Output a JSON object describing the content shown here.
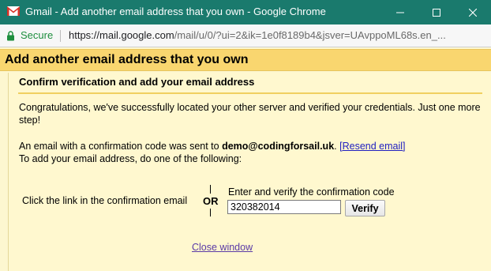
{
  "window": {
    "title": "Gmail - Add another email address that you own - Google Chrome",
    "controls": [
      "minimize",
      "maximize",
      "close"
    ]
  },
  "addressbar": {
    "secure_label": "Secure",
    "url_host": "https://mail.google.com",
    "url_rest": "/mail/u/0/?ui=2&ik=1e0f8189b4&jsver=UAvppoML68s.en_..."
  },
  "dialog": {
    "heading": "Add another email address that you own",
    "subheading": "Confirm verification and add your email address",
    "congrats": "Congratulations, we've successfully located your other server and verified your credentials. Just one more step!",
    "sent_prefix": "An email with a confirmation code was sent to ",
    "sent_email": "demo@codingforsail.uk",
    "sent_after": ". ",
    "bracket_open": "[",
    "resend_link": "Resend email",
    "bracket_close": "]",
    "instructions": "To add your email address, do one of the following:",
    "option_link_text": "Click the link in the confirmation email",
    "or_label": "OR",
    "option_code_label": "Enter and verify the confirmation code",
    "code_value": "320382014",
    "verify_label": "Verify",
    "close_label": "Close window"
  },
  "colors": {
    "titlebar": "#1a7a6d",
    "heading_bar": "#f9d66f",
    "panel_bg": "#fff8cf",
    "link": "#2020c0",
    "secure_green": "#1e8e3e"
  },
  "icons": {
    "app": "gmail-icon",
    "lock": "lock-icon"
  }
}
